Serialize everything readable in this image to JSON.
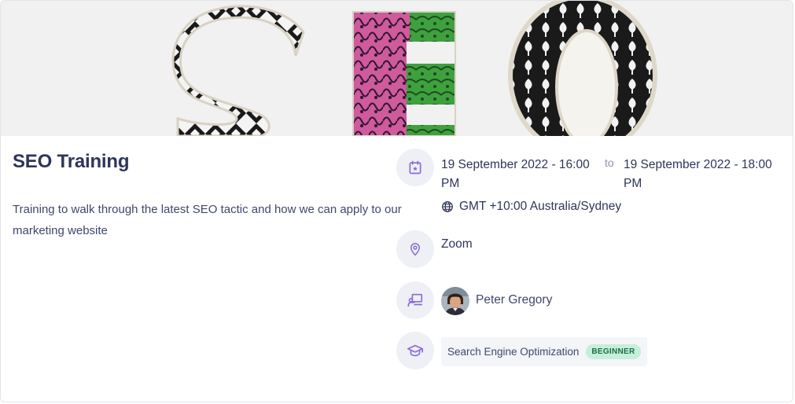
{
  "event": {
    "title": "SEO Training",
    "description": "Training to walk through the latest SEO tactic and how we can apply to our marketing website",
    "start": "19 September 2022 - 16:00 PM",
    "to_label": "to",
    "end": "19 September 2022 - 18:00 PM",
    "timezone": "GMT +10:00 Australia/Sydney",
    "location": "Zoom",
    "instructor": "Peter Gregory",
    "course": "Search Engine Optimization",
    "level": "BEGINNER"
  },
  "icons": {
    "date": "calendar-star-icon",
    "timezone": "globe-icon",
    "location": "map-pin-icon",
    "instructor": "presentation-icon",
    "course": "graduation-cap-icon"
  },
  "colors": {
    "accent": "#8a6ad8",
    "title": "#2f3559",
    "badge_bg": "#c6efd9",
    "badge_text": "#1f6b49"
  }
}
